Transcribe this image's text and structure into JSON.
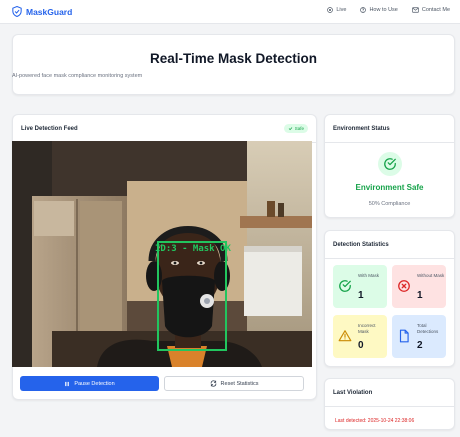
{
  "brand": {
    "name": "MaskGuard",
    "icon": "shield-check-icon",
    "color": "#2563eb"
  },
  "nav": {
    "items": [
      {
        "label": "Live",
        "icon": "live-record-icon"
      },
      {
        "label": "How to Use",
        "icon": "help-circle-icon"
      },
      {
        "label": "Contact Me",
        "icon": "mail-icon"
      }
    ]
  },
  "hero": {
    "title": "Real-Time Mask Detection",
    "subtitle": "AI-powered face mask compliance monitoring system"
  },
  "feed": {
    "title": "Live Detection Feed",
    "badge": "Safe",
    "detection_label": "ID:3 - Mask OK",
    "detection_color": "#22c55e"
  },
  "controls": {
    "pause_label": "Pause Detection",
    "reset_label": "Reset Statistics"
  },
  "environment": {
    "title": "Environment Status",
    "status": "Environment Safe",
    "compliance": "50% Compliance",
    "status_color": "#16a34a"
  },
  "stats": {
    "title": "Detection Statistics",
    "tiles": [
      {
        "label": "With Mask",
        "value": "1",
        "icon": "check-circle-icon",
        "bg": "#dcfce7",
        "fg": "#16a34a"
      },
      {
        "label": "Without Mask",
        "value": "1",
        "icon": "x-circle-icon",
        "bg": "#fee2e2",
        "fg": "#dc2626"
      },
      {
        "label": "Incorrect Mask",
        "value": "0",
        "icon": "warning-triangle-icon",
        "bg": "#fef9c3",
        "fg": "#ca8a04"
      },
      {
        "label": "Total Detections",
        "value": "2",
        "icon": "document-icon",
        "bg": "#dbeafe",
        "fg": "#2563eb"
      }
    ]
  },
  "violation": {
    "title": "Last Violation",
    "text": "Last detected: 2025-10-24 22:38:06"
  }
}
